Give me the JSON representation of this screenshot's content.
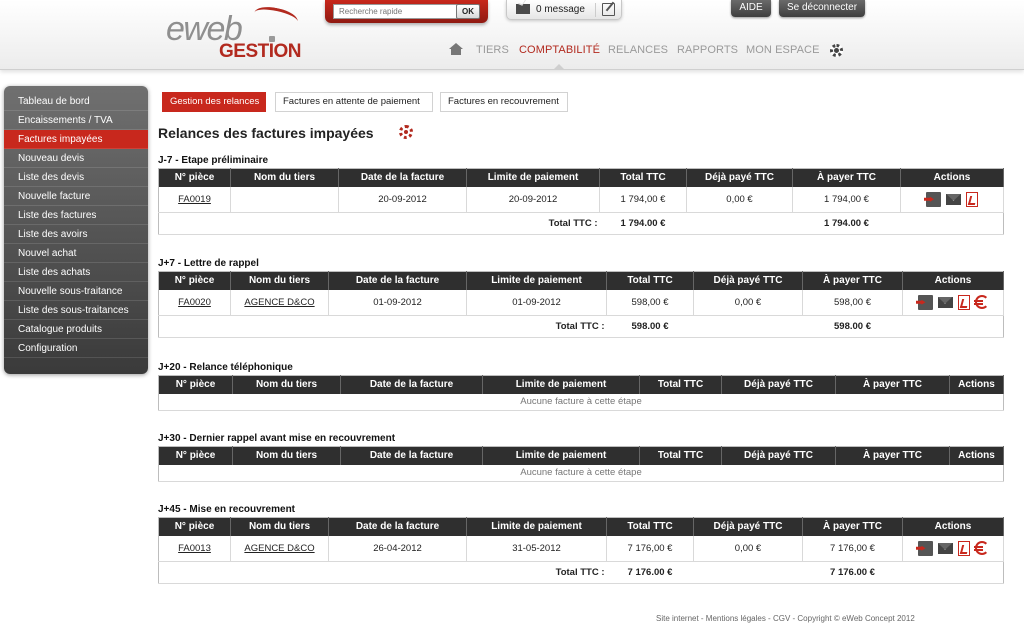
{
  "brand": {
    "logo_main": "eweb",
    "logo_sub": "GESTION"
  },
  "search": {
    "placeholder": "Recherche rapide",
    "button": "OK"
  },
  "messages": {
    "label": "0 message"
  },
  "top_buttons": {
    "help": "AIDE",
    "logout": "Se déconnecter"
  },
  "main_nav": {
    "items": [
      "TIERS",
      "COMPTABILITÉ",
      "RELANCES",
      "RAPPORTS",
      "MON ESPACE"
    ],
    "active": "COMPTABILITÉ"
  },
  "sidebar": {
    "items": [
      "Tableau de bord",
      "Encaissements / TVA",
      "Factures impayées",
      "Nouveau devis",
      "Liste des devis",
      "Nouvelle facture",
      "Liste des factures",
      "Liste des avoirs",
      "Nouvel achat",
      "Liste des achats",
      "Nouvelle sous-traitance",
      "Liste des sous-traitances",
      "Catalogue produits",
      "Configuration"
    ],
    "active_index": 2
  },
  "tabs": [
    "Gestion des relances",
    "Factures en attente de paiement",
    "Factures en recouvrement"
  ],
  "page_title": "Relances des factures impayées",
  "columns": [
    "N° pièce",
    "Nom du tiers",
    "Date de la facture",
    "Limite de paiement",
    "Total TTC",
    "Déjà payé TTC",
    "À payer TTC",
    "Actions"
  ],
  "total_label": "Total TTC :",
  "empty_message": "Aucune facture à cette étape",
  "sections": [
    {
      "title": "J-7 - Etape préliminaire",
      "rows": [
        {
          "piece": "FA0019",
          "tiers": "",
          "date": "20-09-2012",
          "limite": "20-09-2012",
          "total": "1 794,00 €",
          "paye": "0,00 €",
          "apayer": "1 794,00 €"
        }
      ],
      "total": "1 794.00 €",
      "total_apayer": "1 794.00 €"
    },
    {
      "title": "J+7 - Lettre de rappel",
      "rows": [
        {
          "piece": "FA0020",
          "tiers": "AGENCE D&CO",
          "date": "01-09-2012",
          "limite": "01-09-2012",
          "total": "598,00 €",
          "paye": "0,00 €",
          "apayer": "598,00 €"
        }
      ],
      "total": "598.00 €",
      "total_apayer": "598.00 €"
    },
    {
      "title": "J+20 - Relance téléphonique",
      "rows": []
    },
    {
      "title": "J+30 - Dernier rappel avant mise en recouvrement",
      "rows": []
    },
    {
      "title": "J+45 - Mise en recouvrement",
      "rows": [
        {
          "piece": "FA0013",
          "tiers": "AGENCE D&CO",
          "date": "26-04-2012",
          "limite": "31-05-2012",
          "total": "7 176,00 €",
          "paye": "0,00 €",
          "apayer": "7 176,00 €"
        }
      ],
      "total": "7 176.00 €",
      "total_apayer": "7 176.00 €"
    }
  ],
  "footer": "Site internet - Mentions légales - CGV - Copyright © eWeb Concept 2012",
  "colors": {
    "brand_red": "#c8281d",
    "header_dark": "#2f2f2f",
    "nav_grey": "#9a9a9a"
  }
}
